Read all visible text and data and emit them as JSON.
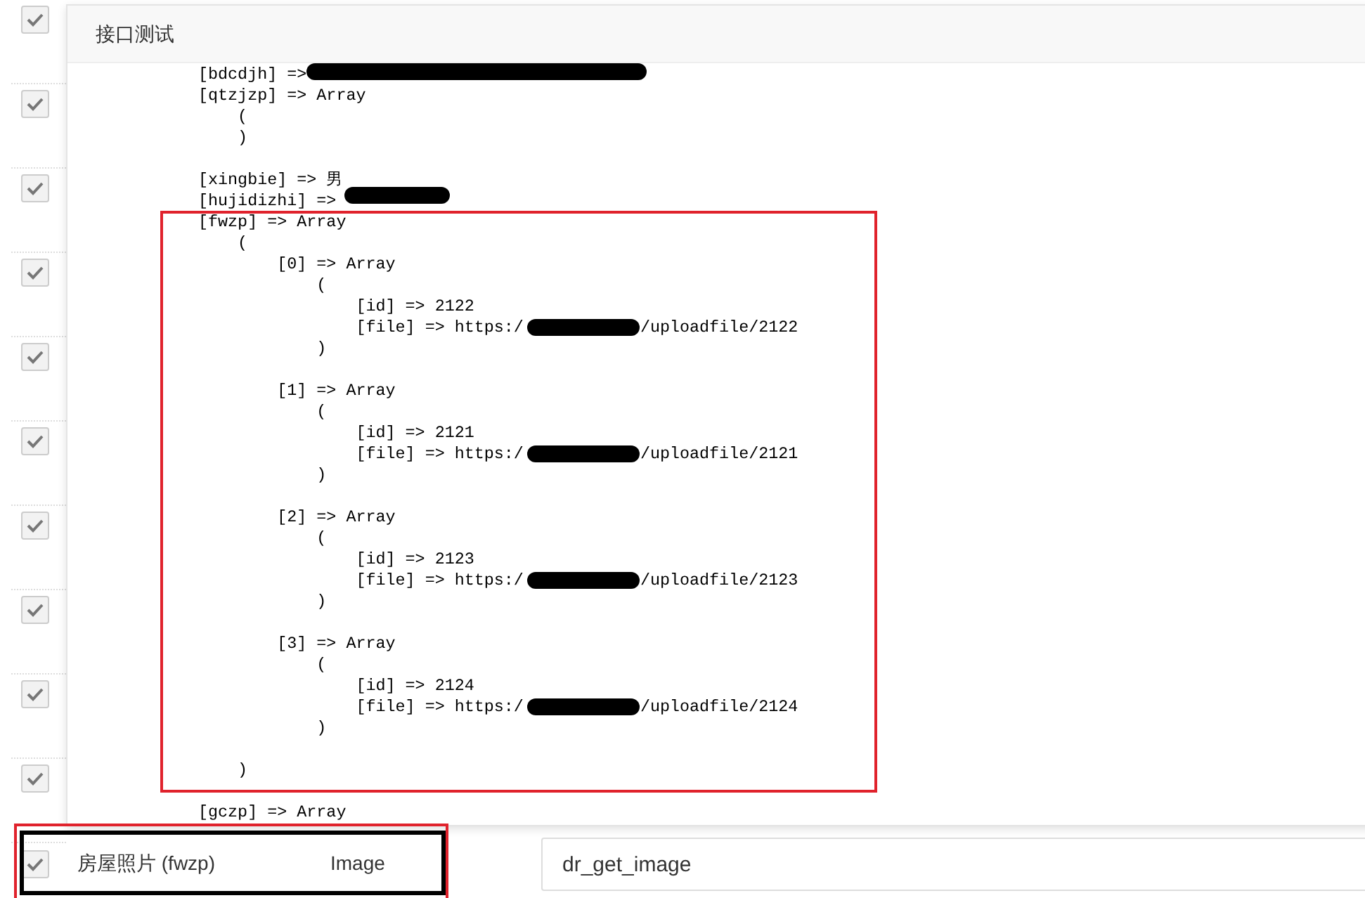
{
  "background_rows": [
    {
      "checked": true
    },
    {
      "checked": true
    },
    {
      "checked": true
    },
    {
      "checked": true
    },
    {
      "checked": true
    },
    {
      "checked": true
    },
    {
      "checked": true
    },
    {
      "checked": true
    },
    {
      "checked": true
    },
    {
      "checked": true
    }
  ],
  "dialog": {
    "title": "接口测试",
    "output_lines": [
      {
        "text": "[bdcdjh] =>"
      },
      {
        "text": "[qtzjzp] => Array"
      },
      {
        "text": "    ("
      },
      {
        "text": "    )"
      },
      {
        "text": "[xingbie] => 男",
        "gap_before": true
      },
      {
        "text": "[hujidizhi] =>"
      },
      {
        "text": "[fwzp] => Array"
      },
      {
        "text": "    ("
      },
      {
        "text": "        [0] => Array"
      },
      {
        "text": "            ("
      },
      {
        "text": "                [id] => 2122"
      },
      {
        "text": "                [file] => https:/",
        "tail": "/uploadfile/2122"
      },
      {
        "text": "            )"
      },
      {
        "text": "        [1] => Array",
        "gap_before": true
      },
      {
        "text": "            ("
      },
      {
        "text": "                [id] => 2121"
      },
      {
        "text": "                [file] => https:/",
        "tail": "/uploadfile/2121"
      },
      {
        "text": "            )"
      },
      {
        "text": "        [2] => Array",
        "gap_before": true
      },
      {
        "text": "            ("
      },
      {
        "text": "                [id] => 2123"
      },
      {
        "text": "                [file] => https:/",
        "tail": "/uploadfile/2123"
      },
      {
        "text": "            )"
      },
      {
        "text": "        [3] => Array",
        "gap_before": true
      },
      {
        "text": "            ("
      },
      {
        "text": "                [id] => 2124"
      },
      {
        "text": "                [file] => https:/",
        "tail": "/uploadfile/2124"
      },
      {
        "text": "            )"
      },
      {
        "text": "    )",
        "gap_before": true
      },
      {
        "text": "[gczp] => Array",
        "gap_before": true
      }
    ]
  },
  "field_row": {
    "checked": true,
    "cells": [
      "房屋照片 (fwzp)",
      "Image"
    ],
    "input_value": "dr_get_image"
  }
}
